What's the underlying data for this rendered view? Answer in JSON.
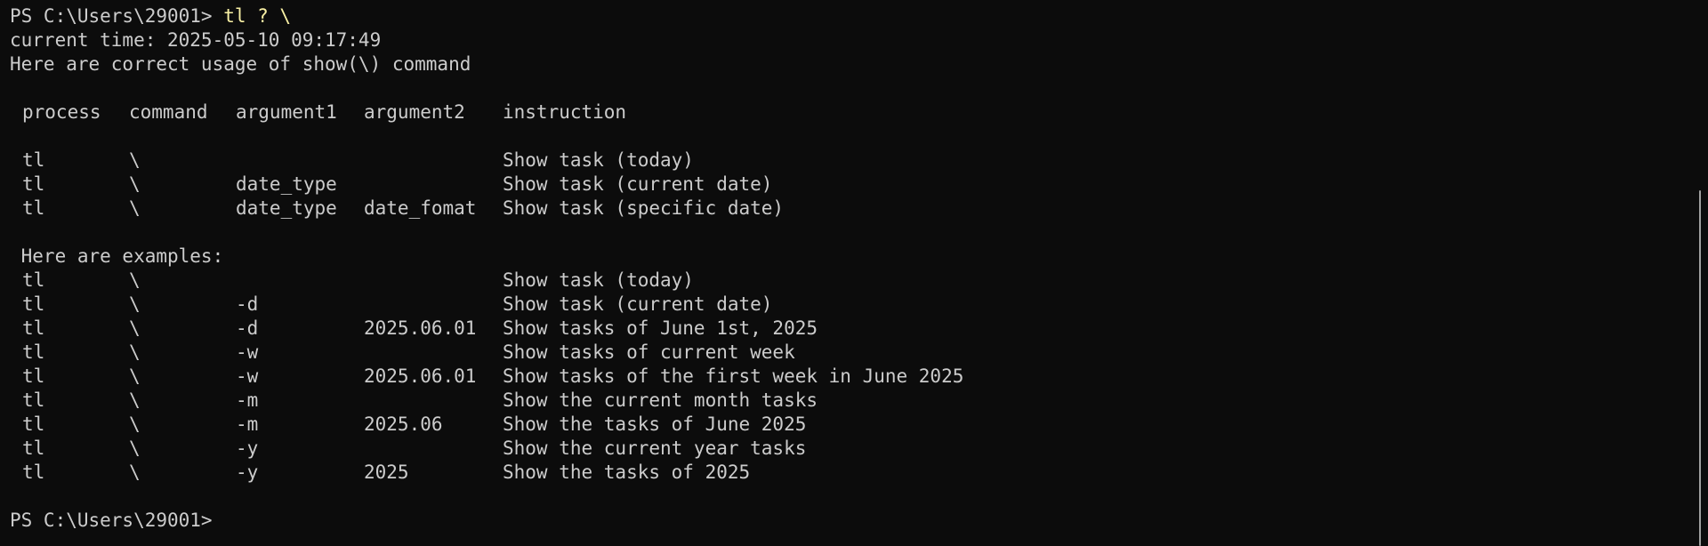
{
  "prompt1": {
    "prefix": "PS C:\\Users\\29001>",
    "command": " tl ? \\"
  },
  "current_time": "current time: 2025-05-10 09:17:49",
  "usage_intro": "Here are correct usage of show(\\) command",
  "headers": {
    "process": "process",
    "command": "command",
    "argument1": "argument1",
    "argument2": "argument2",
    "instruction": "instruction"
  },
  "usage_rows": [
    {
      "process": "tl",
      "command": "\\",
      "argument1": "",
      "argument2": "",
      "instruction": "Show task (today)"
    },
    {
      "process": "tl",
      "command": "\\",
      "argument1": "date_type",
      "argument2": "",
      "instruction": "Show task (current date)"
    },
    {
      "process": "tl",
      "command": "\\",
      "argument1": "date_type",
      "argument2": "date_fomat",
      "instruction": "Show task (specific date)"
    }
  ],
  "examples_intro": " Here are examples:",
  "example_rows": [
    {
      "process": "tl",
      "command": "\\",
      "argument1": "",
      "argument2": "",
      "instruction": "Show task (today)"
    },
    {
      "process": "tl",
      "command": "\\",
      "argument1": "-d",
      "argument2": "",
      "instruction": "Show task (current date)"
    },
    {
      "process": "tl",
      "command": "\\",
      "argument1": "-d",
      "argument2": "2025.06.01",
      "instruction": "Show tasks of June 1st, 2025"
    },
    {
      "process": "tl",
      "command": "\\",
      "argument1": "-w",
      "argument2": "",
      "instruction": "Show tasks of current week"
    },
    {
      "process": "tl",
      "command": "\\",
      "argument1": "-w",
      "argument2": "2025.06.01",
      "instruction": "Show tasks of the first week in June 2025"
    },
    {
      "process": "tl",
      "command": "\\",
      "argument1": "-m",
      "argument2": "",
      "instruction": "Show the current month tasks"
    },
    {
      "process": "tl",
      "command": "\\",
      "argument1": "-m",
      "argument2": "2025.06",
      "instruction": "Show the tasks of June 2025"
    },
    {
      "process": "tl",
      "command": "\\",
      "argument1": "-y",
      "argument2": "",
      "instruction": "Show the current year tasks"
    },
    {
      "process": "tl",
      "command": "\\",
      "argument1": "-y",
      "argument2": "2025",
      "instruction": "Show the tasks of 2025"
    }
  ],
  "prompt2": {
    "prefix": "PS C:\\Users\\29001>"
  }
}
